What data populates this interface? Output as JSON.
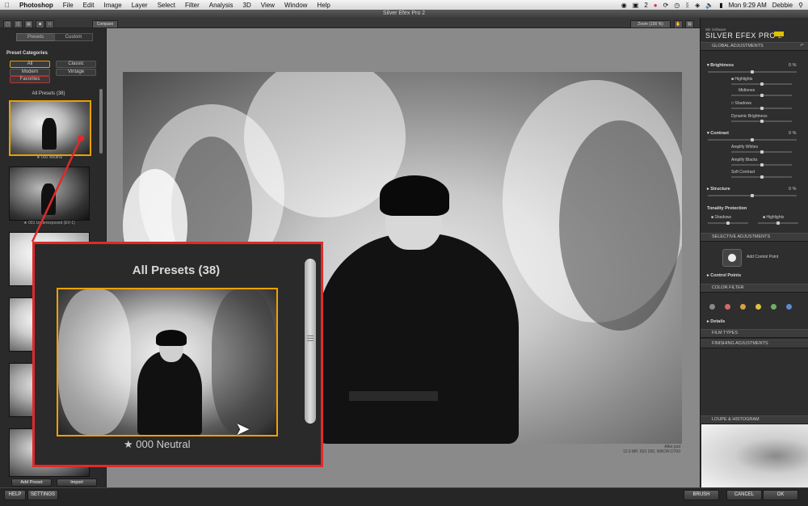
{
  "menubar": {
    "apple": "",
    "app": "Photoshop",
    "items": [
      "File",
      "Edit",
      "Image",
      "Layer",
      "Select",
      "Filter",
      "Analysis",
      "3D",
      "View",
      "Window",
      "Help"
    ],
    "right": [
      "2",
      "Mon 9:29 AM",
      "Debbie"
    ]
  },
  "window_title": "Silver Efex Pro 2",
  "toolbar": {
    "compare": "Compare",
    "zoom": "Zoom (100 %)"
  },
  "left": {
    "tabs": [
      "Presets",
      "Custom"
    ],
    "categories_title": "Preset Categories",
    "categories": [
      "All",
      "Classic",
      "Modern",
      "Vintage",
      "Favorites"
    ],
    "list_title": "All Presets (38)",
    "presets": [
      "000 Neutral",
      "001 Underexposed (EV-1)"
    ],
    "add_preset": "Add Preset",
    "import": "Import"
  },
  "photo_caption": {
    "file": "After.psd",
    "meta": "12.0 MP, ISO 200, NIKON D700"
  },
  "right": {
    "brand_small": "Nik Software",
    "brand": "SILVER EFEX PRO",
    "brand_num": "2",
    "global": "GLOBAL ADJUSTMENTS",
    "brightness": "Brightness",
    "brightness_val": "0 %",
    "highlights": "Highlights",
    "midtones": "Midtones",
    "shadows": "Shadows",
    "dyn_brightness": "Dynamic Brightness",
    "contrast": "Contrast",
    "contrast_val": "0 %",
    "amp_whites": "Amplify Whites",
    "amp_blacks": "Amplify Blacks",
    "soft_contrast": "Soft Contrast",
    "structure": "Structure",
    "structure_val": "0 %",
    "tonality": "Tonality Protection",
    "tp_shadows": "Shadows",
    "tp_highlights": "Highlights",
    "selective": "SELECTIVE ADJUSTMENTS",
    "add_cp": "Add Control Point",
    "control_points": "Control Points",
    "color_filter": "COLOR FILTER",
    "filter_colors": [
      "#888888",
      "#d06a6a",
      "#d8a040",
      "#e0c040",
      "#70b060",
      "#5a8ad0"
    ],
    "details": "Details",
    "film_types": "FILM TYPES",
    "finishing": "FINISHING ADJUSTMENTS",
    "loupe": "LOUPE & HISTOGRAM"
  },
  "bottom": {
    "help": "HELP",
    "settings": "SETTINGS",
    "brush": "BRUSH",
    "cancel": "CANCEL",
    "ok": "OK"
  },
  "zoom": {
    "title": "All Presets (38)",
    "label": "000 Neutral"
  }
}
